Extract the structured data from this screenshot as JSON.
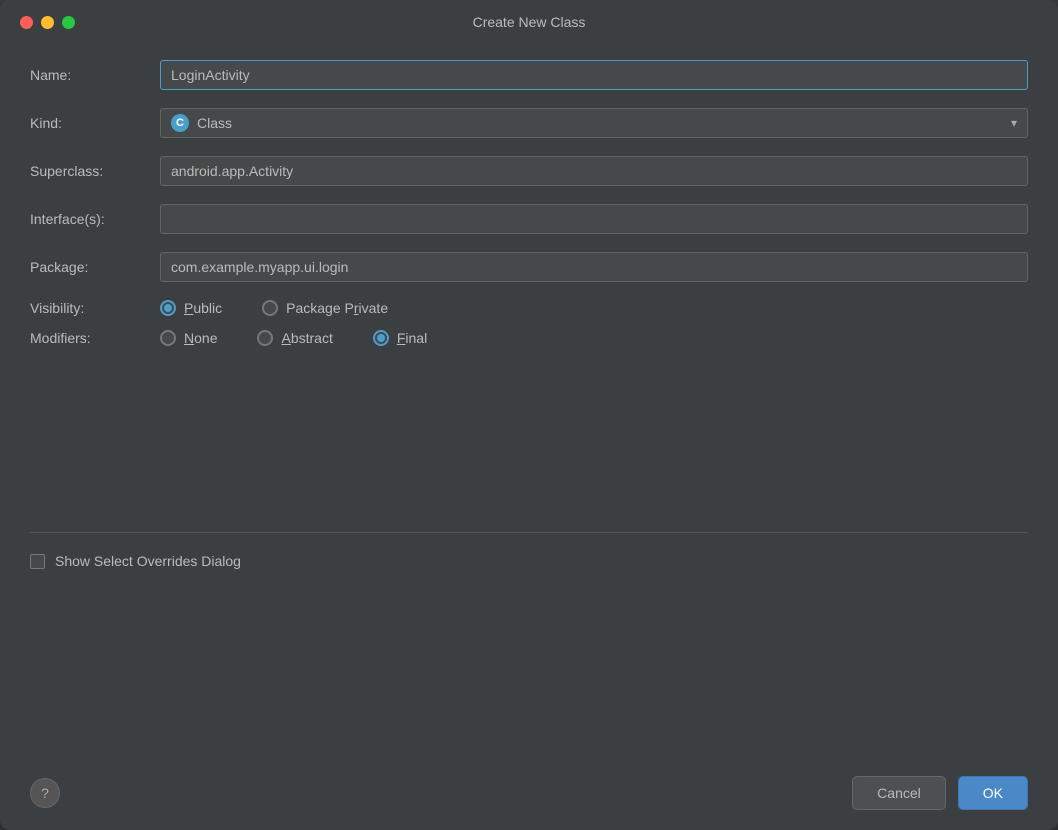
{
  "titleBar": {
    "title": "Create New Class",
    "buttons": {
      "close": "close",
      "minimize": "minimize",
      "maximize": "maximize"
    }
  },
  "form": {
    "nameLabel": "Name:",
    "nameValue": "LoginActivity",
    "kindLabel": "Kind:",
    "kindValue": "Class",
    "kindIconText": "C",
    "superclassLabel": "Superclass:",
    "superclassValue": "android.app.Activity",
    "interfacesLabel": "Interface(s):",
    "interfacesValue": "",
    "packageLabel": "Package:",
    "packageValue": "com.example.myapp.ui.login",
    "visibilityLabel": "Visibility:",
    "visibility": {
      "options": [
        {
          "id": "public",
          "label": "Public",
          "underline": "P",
          "checked": true
        },
        {
          "id": "package-private",
          "label": "Package Private",
          "underline": "R",
          "checked": false
        }
      ]
    },
    "modifiersLabel": "Modifiers:",
    "modifiers": {
      "options": [
        {
          "id": "none",
          "label": "None",
          "underline": "N",
          "checked": false
        },
        {
          "id": "abstract",
          "label": "Abstract",
          "underline": "A",
          "checked": false
        },
        {
          "id": "final",
          "label": "Final",
          "underline": "F",
          "checked": true
        }
      ]
    }
  },
  "checkbox": {
    "label": "Show Select Overrides Dialog",
    "checked": false
  },
  "footer": {
    "helpIcon": "?",
    "cancelLabel": "Cancel",
    "okLabel": "OK"
  }
}
